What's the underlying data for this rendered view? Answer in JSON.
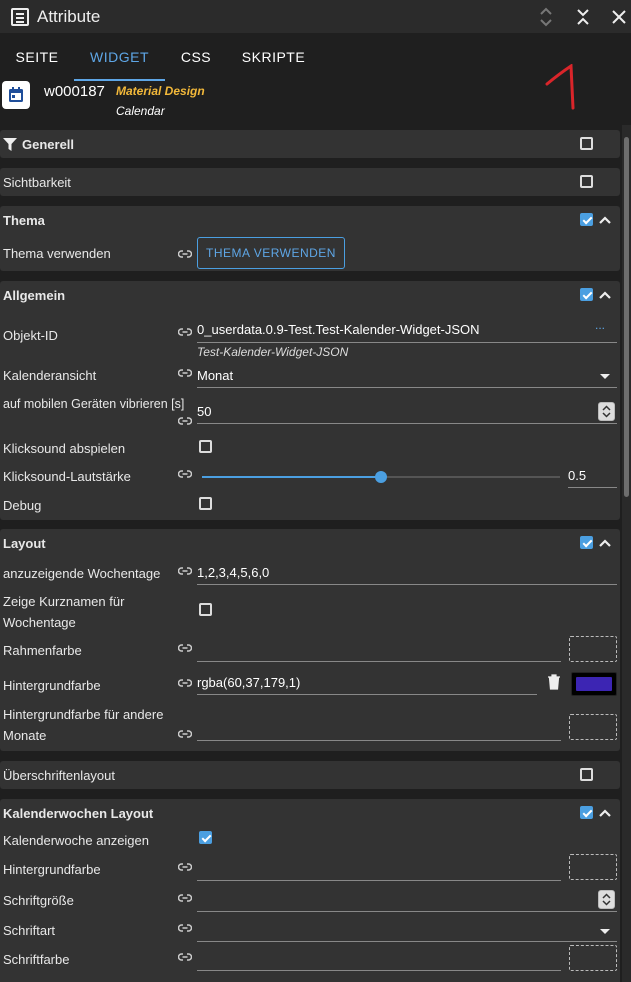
{
  "window": {
    "title": "Attribute"
  },
  "tabs": [
    {
      "label": "SEITE"
    },
    {
      "label": "WIDGET"
    },
    {
      "label": "CSS"
    },
    {
      "label": "SKRIPTE"
    }
  ],
  "widget": {
    "id": "w000187",
    "set": "Material Design",
    "name": "Calendar",
    "icon": "calendar-icon"
  },
  "groups": {
    "generell": {
      "title": "Generell"
    },
    "sichtbarkeit": {
      "title": "Sichtbarkeit"
    },
    "thema": {
      "title": "Thema",
      "use_theme_label": "Thema verwenden",
      "use_theme_button": "THEMA VERWENDEN"
    },
    "allgemein": {
      "title": "Allgemein",
      "objekt_id_label": "Objekt-ID",
      "objekt_id_value": "0_userdata.0.9-Test.Test-Kalender-Widget-JSON",
      "objekt_id_hint": "Test-Kalender-Widget-JSON",
      "objekt_id_more": "...",
      "kalenderansicht_label": "Kalenderansicht",
      "kalenderansicht_value": "Monat",
      "vibrate_label": "auf mobilen Geräten vibrieren [s]",
      "vibrate_value": "50",
      "clicksound_label": "Klicksound abspielen",
      "volume_label": "Klicksound-Lautstärke",
      "volume_value": "0.5",
      "volume_fraction": 0.5,
      "debug_label": "Debug"
    },
    "layout": {
      "title": "Layout",
      "weekdays_label": "anzuzeigende Wochentage",
      "weekdays_value": "1,2,3,4,5,6,0",
      "shortnames_label_1": "Zeige Kurznamen für",
      "shortnames_label_2": "Wochentage",
      "border_color_label": "Rahmenfarbe",
      "bg_color_label": "Hintergrundfarbe",
      "bg_color_value": "rgba(60,37,179,1)",
      "bg_color_swatch": "#3c25b3",
      "bg_other_label_1": "Hintergrundfarbe für andere",
      "bg_other_label_2": "Monate"
    },
    "ueberschriften": {
      "title": "Überschriftenlayout"
    },
    "kw": {
      "title": "Kalenderwochen Layout",
      "show_label": "Kalenderwoche anzeigen",
      "bg_label": "Hintergrundfarbe",
      "fontsize_label": "Schriftgröße",
      "font_label": "Schriftart",
      "fontcolor_label": "Schriftfarbe"
    }
  },
  "colors": {
    "accent": "#4b9fe1",
    "set_name": "#f3b93a",
    "annotation": "#d9252a"
  }
}
